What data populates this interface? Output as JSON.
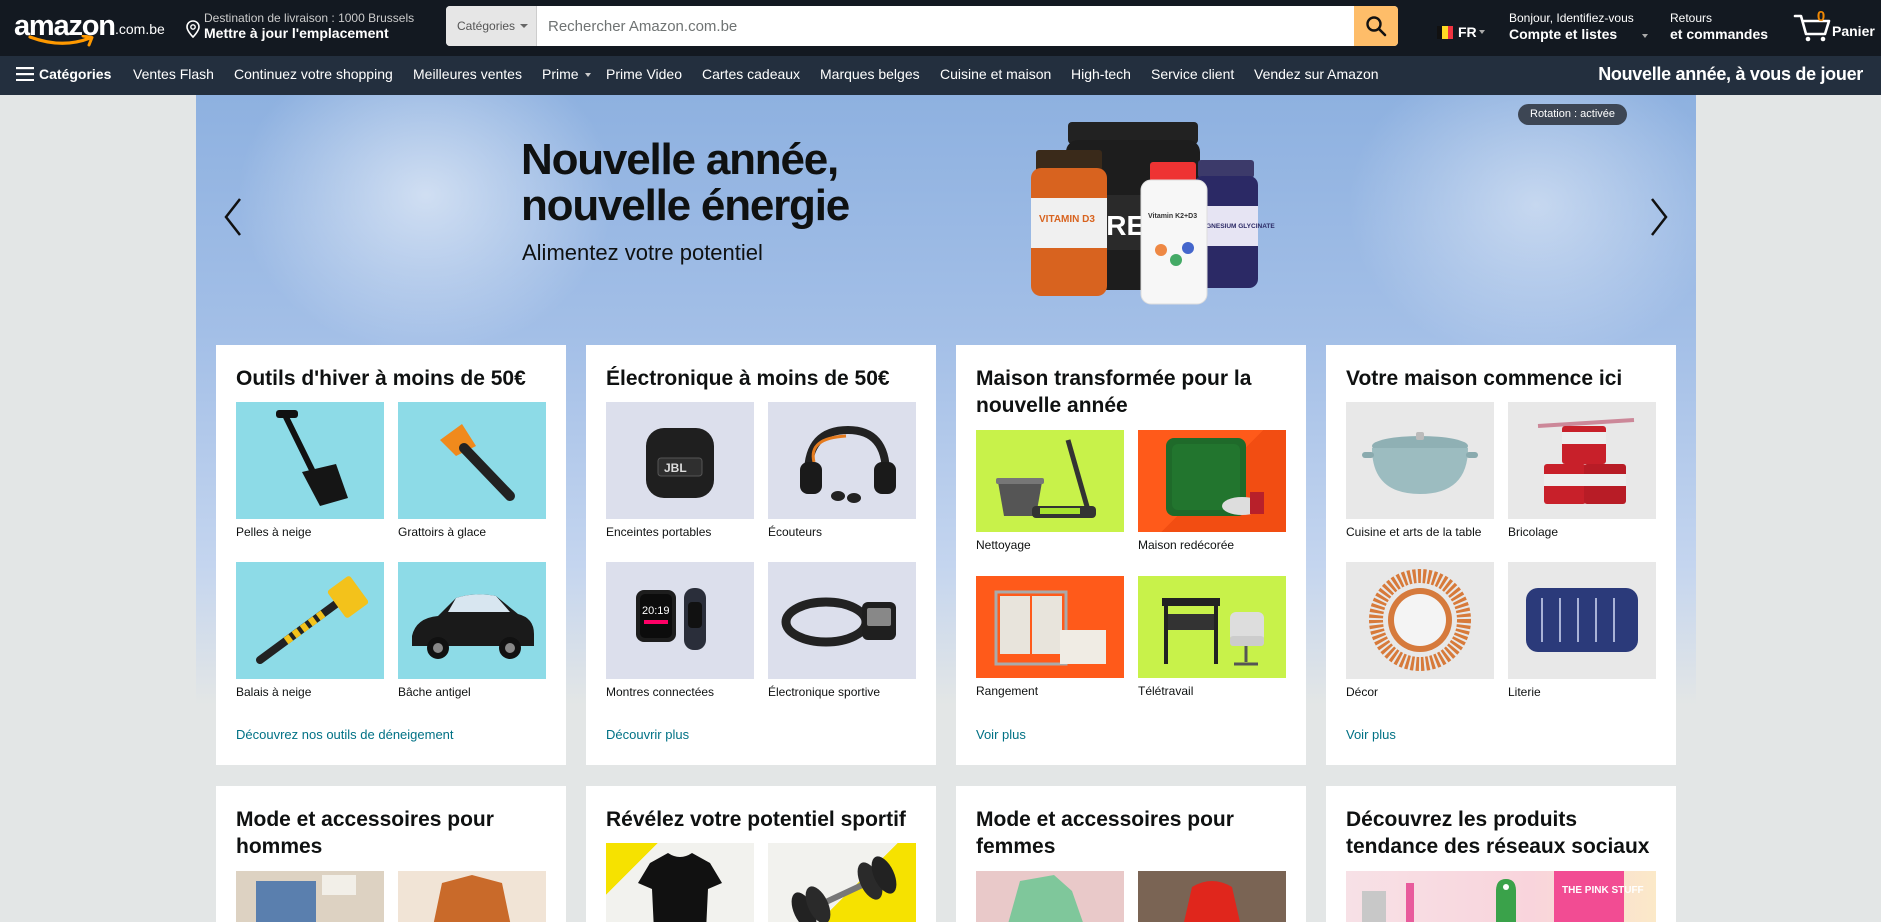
{
  "header": {
    "logo_word": "amazon",
    "logo_tld": ".com.be",
    "delivery_line1": "Destination de livraison : 1000 Brussels",
    "delivery_line2": "Mettre à jour l'emplacement",
    "search_category": "Catégories",
    "search_placeholder": "Rechercher Amazon.com.be",
    "language": "FR",
    "account_line1": "Bonjour, Identifiez-vous",
    "account_line2": "Compte et listes",
    "returns_line1": "Retours",
    "returns_line2": "et commandes",
    "cart_count": "0",
    "cart_label": "Panier"
  },
  "subnav": {
    "all_label": "Catégories",
    "items": [
      "Ventes Flash",
      "Continuez votre shopping",
      "Meilleures ventes",
      "Prime",
      "Prime Video",
      "Cartes cadeaux",
      "Marques belges",
      "Cuisine et maison",
      "High-tech",
      "Service client",
      "Vendez sur Amazon"
    ],
    "promo": "Nouvelle année, à vous de jouer"
  },
  "hero": {
    "title_line1": "Nouvelle année,",
    "title_line2": "nouvelle énergie",
    "subtitle": "Alimentez votre potentiel",
    "rotation": "Rotation : activée",
    "bottle_labels": [
      "VITAMIN D3",
      "CREATINE",
      "Vitamin K2+D3",
      "MAGNESIUM GLYCINATE"
    ]
  },
  "cards": [
    {
      "title": "Outils d'hiver à moins de 50€",
      "tiles": [
        "Pelles à neige",
        "Grattoirs à glace",
        "Balais à neige",
        "Bâche antigel"
      ],
      "link": "Découvrez nos outils de déneigement"
    },
    {
      "title": "Électronique à moins de 50€",
      "tiles": [
        "Enceintes portables",
        "Écouteurs",
        "Montres connectées",
        "Électronique sportive"
      ],
      "link": "Découvrir plus"
    },
    {
      "title": "Maison transformée pour la nouvelle année",
      "tiles": [
        "Nettoyage",
        "Maison redécorée",
        "Rangement",
        "Télétravail"
      ],
      "link": "Voir plus"
    },
    {
      "title": "Votre maison commence ici",
      "tiles": [
        "Cuisine et arts de la table",
        "Bricolage",
        "Décor",
        "Literie"
      ],
      "link": "Voir plus"
    },
    {
      "title": "Mode et accessoires pour hommes"
    },
    {
      "title": "Révélez votre potentiel sportif"
    },
    {
      "title": "Mode et accessoires pour femmes"
    },
    {
      "title": "Découvrez les produits tendance des réseaux sociaux",
      "promo_text": "THE PINK STUFF"
    }
  ],
  "colors": {
    "nav_dark": "#131921",
    "nav_sub": "#232f3e",
    "search_button": "#febd69",
    "cart_count": "#f08804",
    "link": "#007185"
  }
}
